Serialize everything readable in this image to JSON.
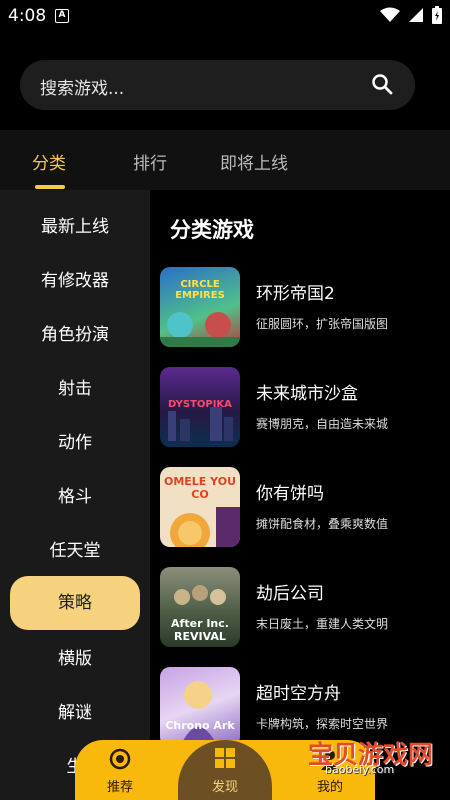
{
  "status": {
    "time": "4:08",
    "notification_glyph": "A"
  },
  "search": {
    "placeholder": "搜索游戏..."
  },
  "tabs": [
    {
      "label": "分类",
      "active": true
    },
    {
      "label": "排行",
      "active": false
    },
    {
      "label": "即将上线",
      "active": false
    }
  ],
  "categories": [
    {
      "label": "最新上线"
    },
    {
      "label": "有修改器"
    },
    {
      "label": "角色扮演"
    },
    {
      "label": "射击"
    },
    {
      "label": "动作"
    },
    {
      "label": "格斗"
    },
    {
      "label": "任天堂"
    },
    {
      "label": "策略",
      "active": true
    },
    {
      "label": "横版"
    },
    {
      "label": "解谜"
    },
    {
      "label": "生"
    }
  ],
  "main": {
    "title": "分类游戏",
    "games": [
      {
        "name": "环形帝国2",
        "desc": "征服圆环，扩张帝国版图",
        "thumb_text": "CIRCLE EMPIRES"
      },
      {
        "name": "未来城市沙盒",
        "desc": "赛博朋克，自由造未来城",
        "thumb_text": "DYSTOPIKA"
      },
      {
        "name": "你有饼吗",
        "desc": "摊饼配食材，叠乘爽数值",
        "thumb_text": "OMELE YOU CO"
      },
      {
        "name": "劫后公司",
        "desc": "末日废土，重建人类文明",
        "thumb_text": "After Inc. REVIVAL"
      },
      {
        "name": "超时空方舟",
        "desc": "卡牌构筑，探索时空世界",
        "thumb_text": "Chrono Ark"
      }
    ]
  },
  "bottom_nav": [
    {
      "label": "推荐",
      "icon": "target-icon"
    },
    {
      "label": "发现",
      "icon": "grid-icon",
      "active": true
    },
    {
      "label": "我的",
      "icon": "user-icon"
    }
  ],
  "watermark": {
    "text": "宝贝游戏网",
    "url": "baobeiy.com"
  },
  "colors": {
    "accent": "#f7c94a",
    "active_category_bg": "#f6d27e",
    "nav_bg": "#f8b80c"
  }
}
